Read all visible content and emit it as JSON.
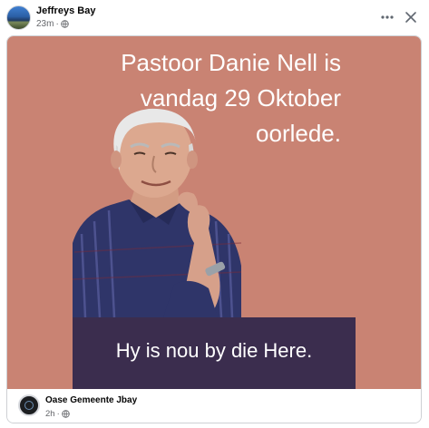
{
  "post": {
    "page_name": "Jeffreys Bay",
    "time": "23m",
    "separator": "·"
  },
  "poster": {
    "headline_lines": [
      "Pastoor Danie Nell is",
      "vandag 29 Oktober",
      "oorlede."
    ],
    "banner_text": "Hy is nou by die Here.",
    "background_color": "#c98373",
    "banner_color": "#3b2d4e"
  },
  "shared": {
    "page_name": "Oase Gemeente Jbay",
    "time": "2h",
    "separator": "·"
  },
  "icons": {
    "more": "more-horizontal-icon",
    "close": "close-icon",
    "audience": "globe-icon"
  }
}
